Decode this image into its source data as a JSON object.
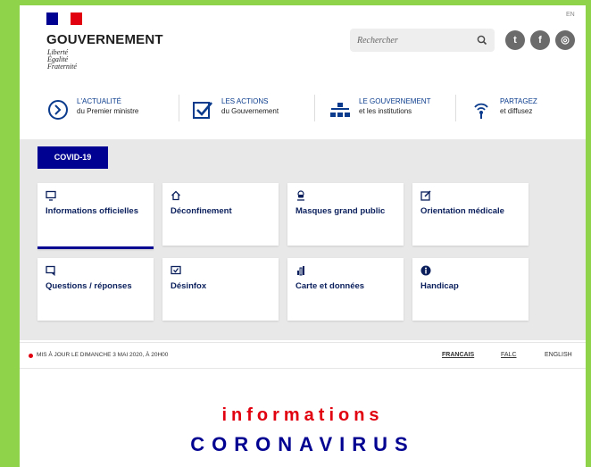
{
  "header": {
    "brand": "GOUVERNEMENT",
    "motto": [
      "Liberté",
      "Égalité",
      "Fraternité"
    ],
    "lang_link": "EN",
    "search_placeholder": "Rechercher",
    "social": [
      {
        "name": "twitter-icon",
        "glyph": "t"
      },
      {
        "name": "facebook-icon",
        "glyph": "f"
      },
      {
        "name": "instagram-icon",
        "glyph": "◎"
      }
    ]
  },
  "nav": [
    {
      "line1": "L'ACTUALITÉ",
      "line2": "du Premier ministre"
    },
    {
      "line1": "LES ACTIONS",
      "line2": "du Gouvernement"
    },
    {
      "line1": "LE GOUVERNEMENT",
      "line2": "et les institutions"
    },
    {
      "line1": "PARTAGEZ",
      "line2": "et diffusez"
    }
  ],
  "covid": {
    "button": "COVID-19",
    "cards": [
      {
        "label": "Informations officielles"
      },
      {
        "label": "Déconfinement"
      },
      {
        "label": "Masques grand public"
      },
      {
        "label": "Orientation médicale"
      },
      {
        "label": "Questions / réponses"
      },
      {
        "label": "Désinfox"
      },
      {
        "label": "Carte et données"
      },
      {
        "label": "Handicap"
      }
    ]
  },
  "update": {
    "text": "MIS À JOUR LE DIMANCHE 3 MAI 2020, À 20H00",
    "languages": [
      "FRANCAIS",
      "FALC",
      "ENGLISH"
    ]
  },
  "banner": {
    "line1": "informations",
    "line2": "CORONAVIRUS"
  },
  "colors": {
    "accent_blue": "#000091",
    "accent_red": "#e1000f",
    "frame_green": "#8fd34a"
  }
}
